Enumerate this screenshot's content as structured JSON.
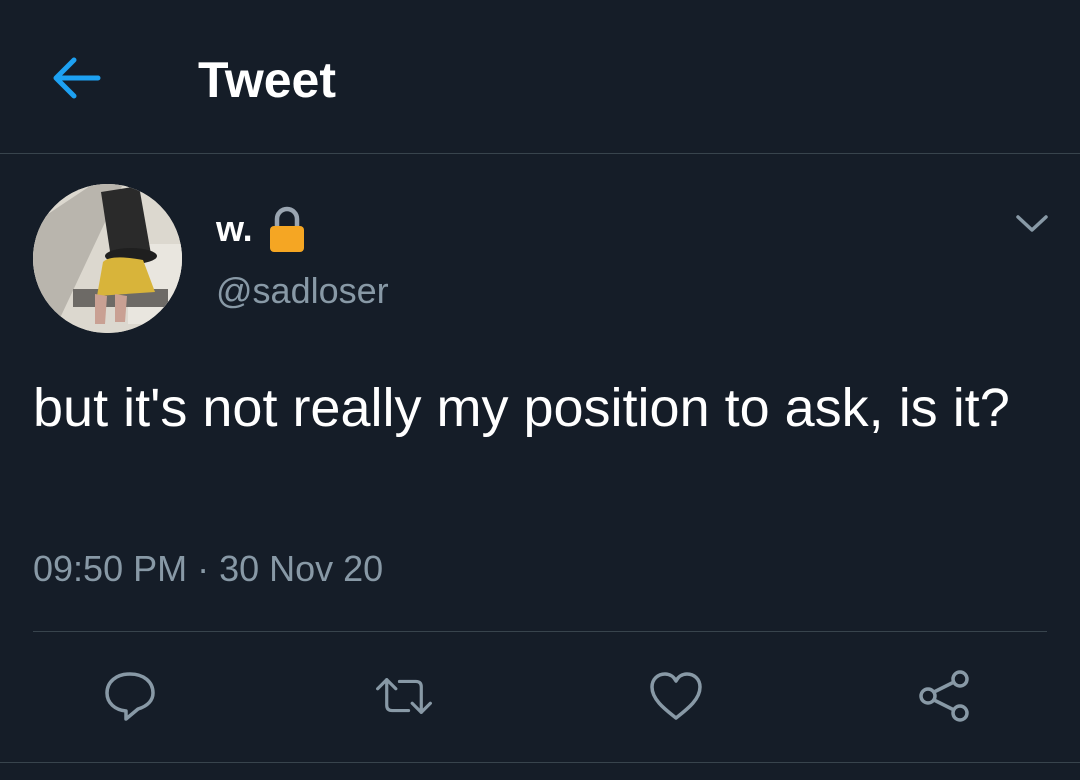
{
  "header": {
    "title": "Tweet",
    "back_icon": "arrow-left-icon"
  },
  "author": {
    "display_name": "w.",
    "handle": "@sadloser",
    "protected_icon": "lock-icon",
    "menu_icon": "chevron-down-icon"
  },
  "tweet": {
    "text": "but it's not really my position to ask, is it?",
    "timestamp": "09:50 PM · 30 Nov 20"
  },
  "actions": [
    {
      "name": "reply",
      "icon": "reply-icon"
    },
    {
      "name": "retweet",
      "icon": "retweet-icon"
    },
    {
      "name": "like",
      "icon": "heart-icon"
    },
    {
      "name": "share",
      "icon": "share-icon"
    }
  ],
  "colors": {
    "background": "#151d28",
    "accent": "#1da1f2",
    "secondary_text": "#8899a6",
    "border": "#38444d",
    "lock": "#f5a623"
  }
}
